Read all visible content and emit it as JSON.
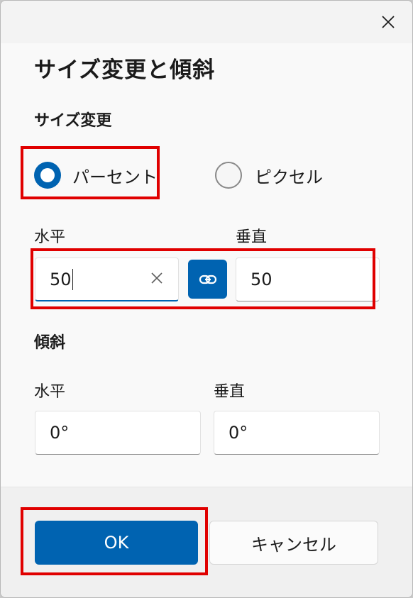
{
  "dialog": {
    "title": "サイズ変更と傾斜",
    "close_icon": "close-icon"
  },
  "resize": {
    "heading": "サイズ変更",
    "options": [
      {
        "label": "パーセント",
        "selected": true
      },
      {
        "label": "ピクセル",
        "selected": false
      }
    ],
    "horizontal_label": "水平",
    "vertical_label": "垂直",
    "horizontal_value": "50",
    "vertical_value": "50",
    "link_icon": "link-icon",
    "clear_icon": "clear-icon"
  },
  "skew": {
    "heading": "傾斜",
    "horizontal_label": "水平",
    "vertical_label": "垂直",
    "horizontal_value": "0°",
    "vertical_value": "0°"
  },
  "buttons": {
    "ok": "OK",
    "cancel": "キャンセル"
  },
  "colors": {
    "accent": "#0063b1",
    "highlight": "#e00000"
  }
}
